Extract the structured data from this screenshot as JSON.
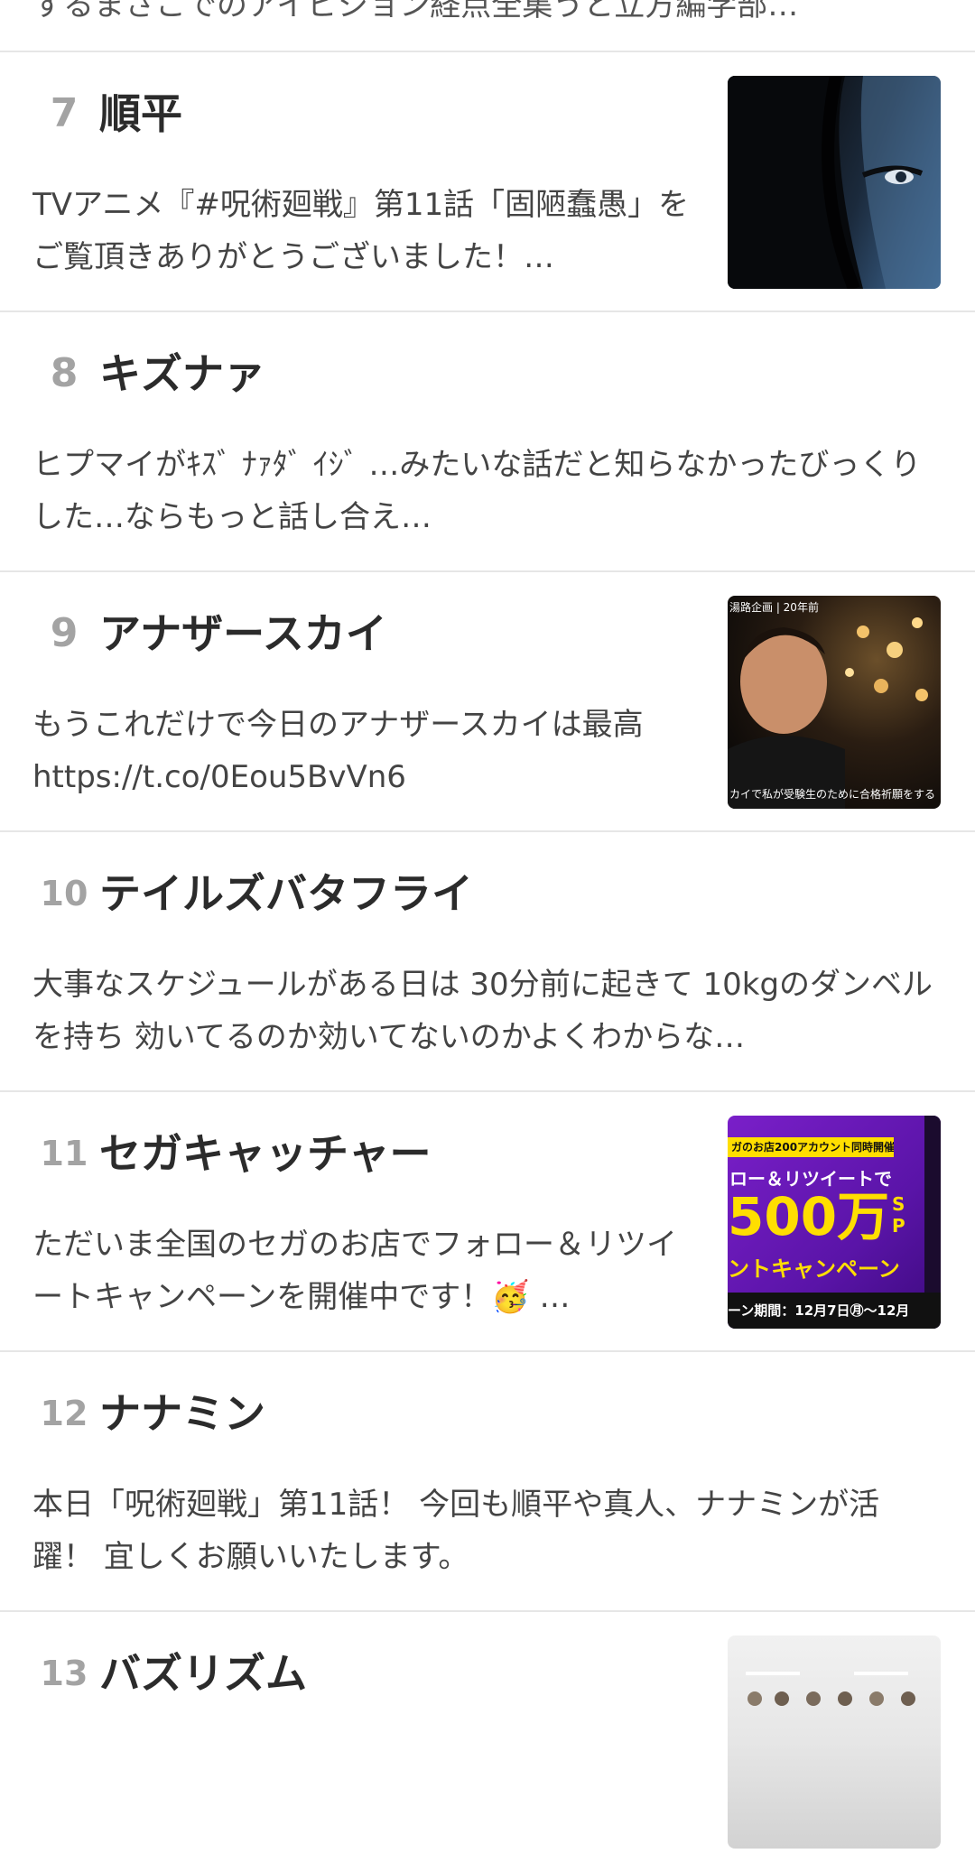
{
  "top_snippet": "するまさこでのアイビジョン経点全集うと立方編学部…",
  "items": [
    {
      "rank": "7",
      "title": "順平",
      "desc": "TVアニメ『#呪術廻戦』第11話「固陋蠢愚」をご覧頂きありがとうございました！…",
      "thumb": "anime-thumbnail"
    },
    {
      "rank": "8",
      "title": "キズナァ",
      "desc": "ヒプマイがｷｽﾞ ﾅｧﾀﾞ ｲｼﾞ …みたいな話だと知らなかったびっくりした…ならもっと話し合え…"
    },
    {
      "rank": "9",
      "title": "アナザースカイ",
      "desc": "もうこれだけで今日のアナザースカイは最高 https://t.co/0Eou5BvVn6",
      "thumb": "video-thumbnail",
      "thumb_top_caption": "湯路企画 | 20年前",
      "thumb_bottom_caption": "カイで私が受験生のために合格祈願をする"
    },
    {
      "rank": "10",
      "title": "テイルズバタフライ",
      "desc": "大事なスケジュールがある日は 30分前に起きて 10kgのダンベルを持ち 効いてるのか効いてないのかよくわからな…"
    },
    {
      "rank": "11",
      "title": "セガキャッチャー",
      "desc": "ただいま全国のセガのお店でフォロー＆リツイートキャンペーンを開催中です！🥳 …",
      "thumb": "campaign-banner",
      "banner_line1": "ガのお店200アカウント同時開催！",
      "banner_line2": "ロー＆リツイートで",
      "banner_line3": "500万",
      "banner_line3_small": "SP",
      "banner_line4": "ントキャンペーン",
      "banner_line5": "ーン期間：12月7日㊊〜12月"
    },
    {
      "rank": "12",
      "title": "ナナミン",
      "desc": "本日「呪術廻戦」第11話！ 今回も順平や真人、ナナミンが活躍！ 宜しくお願いいたします。"
    },
    {
      "rank": "13",
      "title": "バズリズム",
      "desc": "",
      "thumb": "studio-thumbnail"
    }
  ]
}
